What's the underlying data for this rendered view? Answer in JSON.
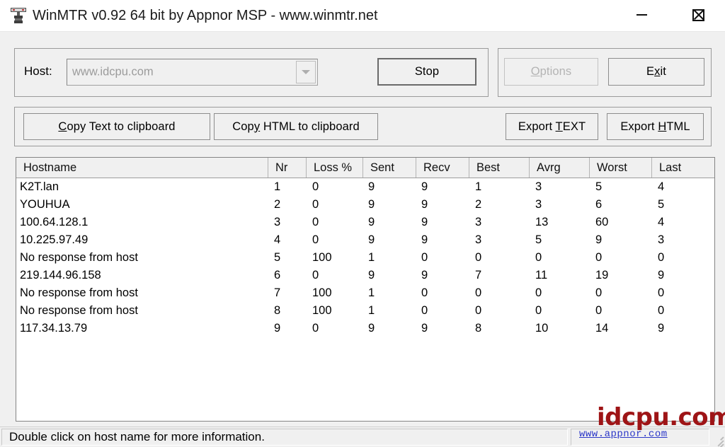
{
  "window": {
    "title": "WinMTR v0.92 64 bit by Appnor MSP - www.winmtr.net",
    "icon": "antenna-icon",
    "minimize_label": "–",
    "maximize_label": "□",
    "close_label": "✕"
  },
  "host_bar": {
    "host_label": "Host:",
    "host_value": "www.idcpu.com",
    "host_placeholder": "www.idcpu.com",
    "dropdown_icon": "chevron-down-icon",
    "stop_label": "Stop",
    "options_label": "Options",
    "options_accel": "O",
    "options_disabled": true,
    "exit_label": "Exit",
    "exit_accel": "x"
  },
  "toolbar": {
    "copy_text_label": "Copy Text to clipboard",
    "copy_text_accel": "C",
    "copy_html_label": "Copy HTML to clipboard",
    "copy_html_accel": "y",
    "export_text_label": "Export TEXT",
    "export_text_accel": "T",
    "export_html_label": "Export HTML",
    "export_html_accel": "H"
  },
  "table": {
    "columns": [
      "Hostname",
      "Nr",
      "Loss %",
      "Sent",
      "Recv",
      "Best",
      "Avrg",
      "Worst",
      "Last"
    ],
    "rows": [
      {
        "hostname": "K2T.lan",
        "nr": "1",
        "loss": "0",
        "sent": "9",
        "recv": "9",
        "best": "1",
        "avrg": "3",
        "worst": "5",
        "last": "4"
      },
      {
        "hostname": "YOUHUA",
        "nr": "2",
        "loss": "0",
        "sent": "9",
        "recv": "9",
        "best": "2",
        "avrg": "3",
        "worst": "6",
        "last": "5"
      },
      {
        "hostname": "100.64.128.1",
        "nr": "3",
        "loss": "0",
        "sent": "9",
        "recv": "9",
        "best": "3",
        "avrg": "13",
        "worst": "60",
        "last": "4"
      },
      {
        "hostname": "10.225.97.49",
        "nr": "4",
        "loss": "0",
        "sent": "9",
        "recv": "9",
        "best": "3",
        "avrg": "5",
        "worst": "9",
        "last": "3"
      },
      {
        "hostname": "No response from host",
        "nr": "5",
        "loss": "100",
        "sent": "1",
        "recv": "0",
        "best": "0",
        "avrg": "0",
        "worst": "0",
        "last": "0"
      },
      {
        "hostname": "219.144.96.158",
        "nr": "6",
        "loss": "0",
        "sent": "9",
        "recv": "9",
        "best": "7",
        "avrg": "11",
        "worst": "19",
        "last": "9"
      },
      {
        "hostname": "No response from host",
        "nr": "7",
        "loss": "100",
        "sent": "1",
        "recv": "0",
        "best": "0",
        "avrg": "0",
        "worst": "0",
        "last": "0"
      },
      {
        "hostname": "No response from host",
        "nr": "8",
        "loss": "100",
        "sent": "1",
        "recv": "0",
        "best": "0",
        "avrg": "0",
        "worst": "0",
        "last": "0"
      },
      {
        "hostname": "117.34.13.79",
        "nr": "9",
        "loss": "0",
        "sent": "9",
        "recv": "9",
        "best": "8",
        "avrg": "10",
        "worst": "14",
        "last": "9"
      }
    ]
  },
  "statusbar": {
    "hint": "Double click on host name for more information.",
    "link": "www.appnor.com"
  },
  "watermark": {
    "text": "idcpu.com",
    "color": "#9e1416"
  }
}
